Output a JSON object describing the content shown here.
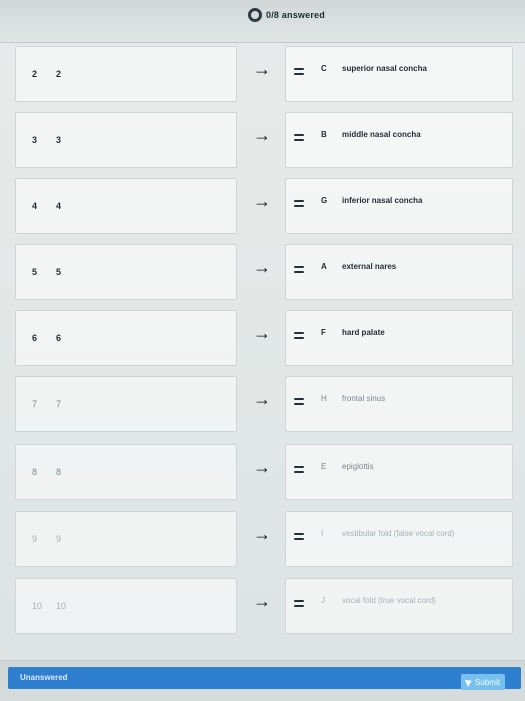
{
  "header": {
    "progress_text": "0/8 answered"
  },
  "rows": [
    {
      "prompt_num": "2",
      "prompt_text": "2",
      "letter": "C",
      "answer": "superior nasal concha"
    },
    {
      "prompt_num": "3",
      "prompt_text": "3",
      "letter": "B",
      "answer": "middle nasal concha"
    },
    {
      "prompt_num": "4",
      "prompt_text": "4",
      "letter": "G",
      "answer": "inferior nasal concha"
    },
    {
      "prompt_num": "5",
      "prompt_text": "5",
      "letter": "A",
      "answer": "external nares"
    },
    {
      "prompt_num": "6",
      "prompt_text": "6",
      "letter": "F",
      "answer": "hard palate"
    },
    {
      "prompt_num": "7",
      "prompt_text": "7",
      "letter": "H",
      "answer": "frontal sinus"
    },
    {
      "prompt_num": "8",
      "prompt_text": "8",
      "letter": "E",
      "answer": "epiglottis"
    },
    {
      "prompt_num": "9",
      "prompt_text": "9",
      "letter": "I",
      "answer": "vestibular fold (false vocal cord)"
    },
    {
      "prompt_num": "10",
      "prompt_text": "10",
      "letter": "J",
      "answer": "vocal fold (true vocal cord)"
    }
  ],
  "footer": {
    "status": "Unanswered",
    "submit_label": "Submit"
  },
  "icons": {
    "progress": "progress-ring-icon",
    "arrow": "right-arrow-icon",
    "drag": "drag-handle-icon",
    "submit": "send-icon"
  },
  "colors": {
    "accent": "#2f7fd0",
    "submit": "#78c0ee",
    "background": "#e3e8e7"
  }
}
